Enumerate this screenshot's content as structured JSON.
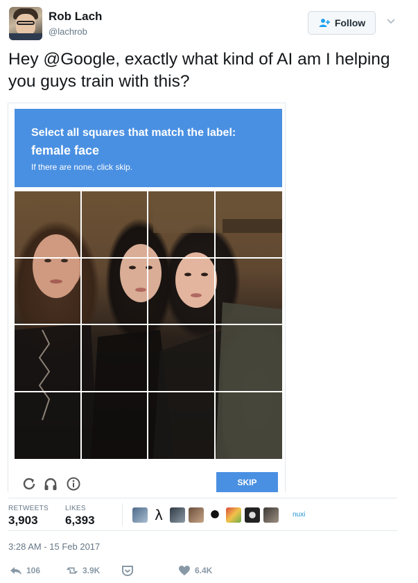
{
  "tweet": {
    "author_name": "Rob Lach",
    "author_handle": "@lachrob",
    "follow_label": "Follow",
    "text": "Hey @Google, exactly what kind of AI am I helping you guys train with this?",
    "timestamp": "3:28 AM - 15 Feb 2017"
  },
  "captcha": {
    "instruction": "Select all squares that match the label:",
    "label": "female face",
    "hint": "If there are none, click skip.",
    "skip_label": "SKIP",
    "grid_rows": 4,
    "grid_cols": 4,
    "colors": {
      "banner": "#4a90e2",
      "skip": "#4a90e2"
    },
    "toolbar_icons": [
      "reload-icon",
      "headphones-icon",
      "info-icon"
    ]
  },
  "stats": {
    "retweets_label": "RETWEETS",
    "retweets_value": "3,903",
    "likes_label": "LIKES",
    "likes_value": "6,393",
    "liker_extra_label": "nuxi"
  },
  "actions": {
    "reply_count": "106",
    "retweet_count": "3.9K",
    "like_count": "6.4K",
    "icons": [
      "reply-icon",
      "retweet-icon",
      "dm-icon",
      "heart-icon"
    ]
  },
  "theme": {
    "accent": "#1da1f2",
    "text": "#14171a",
    "muted": "#657786"
  }
}
